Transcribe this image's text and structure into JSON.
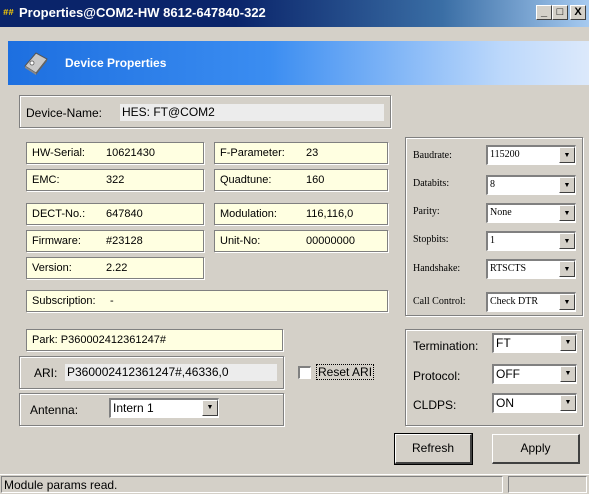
{
  "window": {
    "title": "Properties@COM2-HW 8612-647840-322",
    "app_icon": "##",
    "minimize": "_",
    "maximize": "□",
    "close": "X"
  },
  "header": {
    "title": "Device Properties",
    "icon": "device-tag-icon"
  },
  "device_name": {
    "label": "Device-Name:",
    "value": "HES: FT@COM2"
  },
  "info": {
    "hw_serial": {
      "label": "HW-Serial:",
      "value": "10621430"
    },
    "emc": {
      "label": "EMC:",
      "value": "322"
    },
    "dect_no": {
      "label": "DECT-No.:",
      "value": "647840"
    },
    "firmware": {
      "label": "Firmware:",
      "value": "#23128"
    },
    "version": {
      "label": "Version:",
      "value": "2.22"
    },
    "f_parameter": {
      "label": "F-Parameter:",
      "value": "23"
    },
    "quadtune": {
      "label": "Quadtune:",
      "value": "160"
    },
    "modulation": {
      "label": "Modulation:",
      "value": "116,116,0"
    },
    "unit_no": {
      "label": "Unit-No:",
      "value": "00000000"
    },
    "subscription": {
      "label": "Subscription:",
      "value": "-"
    }
  },
  "serial": {
    "baudrate": {
      "label": "Baudrate:",
      "value": "115200"
    },
    "databits": {
      "label": "Databits:",
      "value": "8"
    },
    "parity": {
      "label": "Parity:",
      "value": "None"
    },
    "stopbits": {
      "label": "Stopbits:",
      "value": "1"
    },
    "handshake": {
      "label": "Handshake:",
      "value": "RTSCTS"
    },
    "call_control": {
      "label": "Call Control:",
      "value": "Check DTR"
    }
  },
  "park": {
    "label": "Park:",
    "value": "P360002412361247#"
  },
  "ari": {
    "label": "ARI:",
    "value": "P360002412361247#,46336,0"
  },
  "reset_ari": {
    "label": "Reset ARI",
    "checked": false
  },
  "antenna": {
    "label": "Antenna:",
    "value": "Intern 1"
  },
  "protocol_box": {
    "termination": {
      "label": "Termination:",
      "value": "FT"
    },
    "protocol": {
      "label": "Protocol:",
      "value": "OFF"
    },
    "cldps": {
      "label": "CLDPS:",
      "value": "ON"
    }
  },
  "buttons": {
    "refresh": "Refresh",
    "apply": "Apply"
  },
  "status": {
    "text": "Module params read."
  },
  "arrow_glyph": "▼"
}
